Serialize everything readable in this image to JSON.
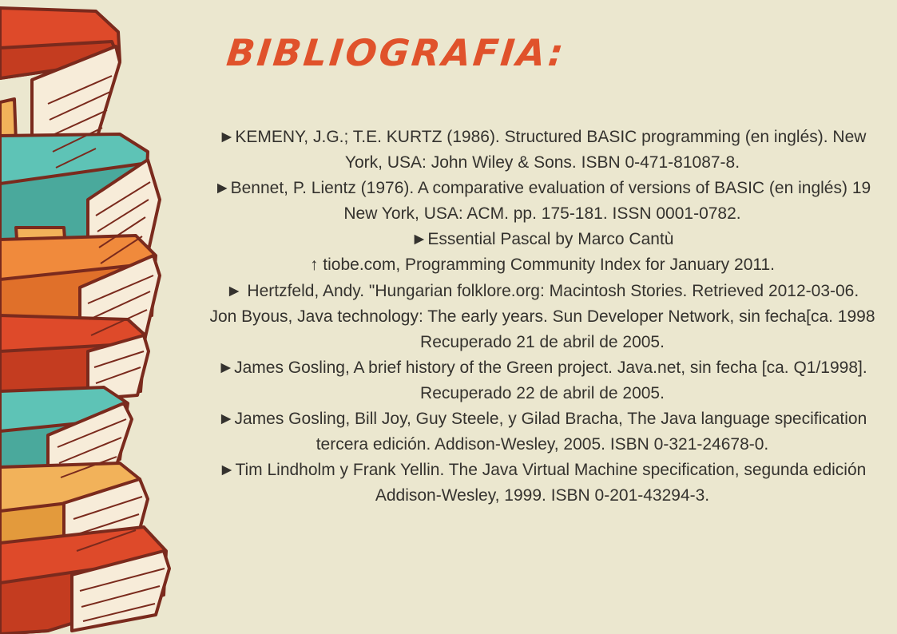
{
  "title": "BIBLIOGRAFIA:",
  "references": [
    "►KEMENY, J.G.; T.E. KURTZ (1986). Structured BASIC programming (en inglés). New",
    "York, USA: John Wiley & Sons. ISBN 0-471-81087-8.",
    "►Bennet, P. Lientz (1976). A comparative evaluation of versions of BASIC (en inglés) 19",
    "New York, USA: ACM. pp. 175-181. ISSN 0001-0782.",
    "►Essential Pascal by Marco Cantù",
    "↑ tiobe.com, Programming Community Index for January 2011.",
    "► Hertzfeld, Andy. \"Hungarian folklore.org: Macintosh Stories. Retrieved 2012-03-06.",
    "Jon Byous, Java technology: The early years. Sun Developer Network, sin fecha[ca. 1998",
    "Recuperado 21 de abril de 2005.",
    "►James Gosling, A brief history of the Green project. Java.net, sin fecha [ca. Q1/1998].",
    "Recuperado 22 de abril de 2005.",
    "►James Gosling, Bill Joy, Guy Steele, y Gilad Bracha, The Java language specification",
    "tercera edición. Addison-Wesley, 2005. ISBN 0-321-24678-0.",
    "►Tim Lindholm y Frank Yellin. The Java Virtual Machine specification, segunda edición",
    "Addison-Wesley, 1999. ISBN 0-201-43294-3."
  ],
  "colors": {
    "background": "#ebe7cf",
    "title": "#e0522b",
    "text": "#34322e",
    "book_red": "#de4a2a",
    "book_orange": "#f08a3c",
    "book_teal": "#5ec3b6",
    "book_yellow": "#f2b25a",
    "outline": "#7a2a1d"
  },
  "illustration": "stack-of-books-illustration"
}
